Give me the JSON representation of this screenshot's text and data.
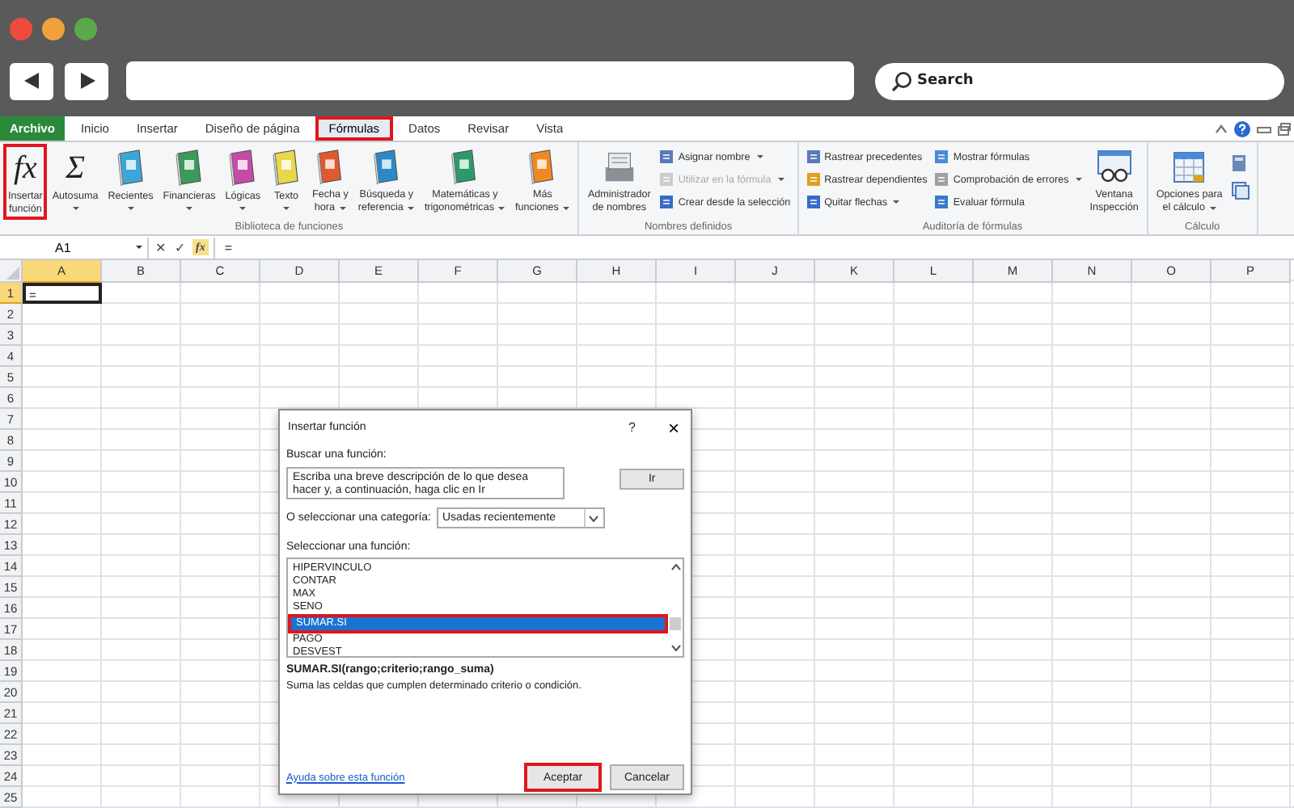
{
  "browser": {
    "search": {
      "placeholder": "Search"
    }
  },
  "ribbon": {
    "tabs": [
      {
        "label": "Archivo",
        "kind": "file",
        "selected": false,
        "highlighted": false
      },
      {
        "label": "Inicio",
        "kind": "tab",
        "selected": false,
        "highlighted": false
      },
      {
        "label": "Insertar",
        "kind": "tab",
        "selected": false,
        "highlighted": false
      },
      {
        "label": "Diseño de página",
        "kind": "tab",
        "selected": false,
        "highlighted": false
      },
      {
        "label": "Fórmulas",
        "kind": "tab",
        "selected": true,
        "highlighted": true
      },
      {
        "label": "Datos",
        "kind": "tab",
        "selected": false,
        "highlighted": false
      },
      {
        "label": "Revisar",
        "kind": "tab",
        "selected": false,
        "highlighted": false
      },
      {
        "label": "Vista",
        "kind": "tab",
        "selected": false,
        "highlighted": false
      }
    ],
    "groups": [
      {
        "label": "Biblioteca de funciones",
        "items": [
          {
            "kind": "large",
            "glyph": "fx",
            "lines": [
              "Insertar",
              "función"
            ],
            "dropdown": false,
            "highlighted": true
          },
          {
            "kind": "large",
            "glyph": "Σ",
            "lines": [
              "Autosuma"
            ],
            "dropdown": true,
            "highlighted": false
          },
          {
            "kind": "large",
            "lines": [
              "Recientes"
            ],
            "dropdown": true,
            "highlighted": false
          },
          {
            "kind": "large",
            "lines": [
              "Financieras"
            ],
            "dropdown": true,
            "highlighted": false
          },
          {
            "kind": "large",
            "lines": [
              "Lógicas"
            ],
            "dropdown": true,
            "highlighted": false
          },
          {
            "kind": "large",
            "lines": [
              "Texto"
            ],
            "dropdown": true,
            "highlighted": false
          },
          {
            "kind": "large",
            "lines": [
              "Fecha y",
              "hora"
            ],
            "dropdown": true,
            "highlighted": false
          },
          {
            "kind": "large",
            "lines": [
              "Búsqueda y",
              "referencia"
            ],
            "dropdown": true,
            "highlighted": false
          },
          {
            "kind": "large",
            "lines": [
              "Matemáticas y",
              "trigonométricas"
            ],
            "dropdown": true,
            "highlighted": false
          },
          {
            "kind": "large",
            "lines": [
              "Más",
              "funciones"
            ],
            "dropdown": true,
            "highlighted": false
          }
        ]
      },
      {
        "label": "Nombres definidos",
        "items": [
          {
            "kind": "large",
            "lines": [
              "Administrador",
              "de nombres"
            ],
            "dropdown": false,
            "highlighted": false
          },
          {
            "kind": "stack",
            "items": [
              {
                "label": "Asignar nombre",
                "dropdown": true,
                "disabled": false
              },
              {
                "label": "Utilizar en la fórmula",
                "dropdown": true,
                "disabled": true
              },
              {
                "label": "Crear desde la selección",
                "dropdown": false,
                "disabled": false
              }
            ]
          }
        ]
      },
      {
        "label": "Auditoría de fórmulas",
        "items": [
          {
            "kind": "stack",
            "items": [
              {
                "label": "Rastrear precedentes",
                "dropdown": false,
                "disabled": false
              },
              {
                "label": "Rastrear dependientes",
                "dropdown": false,
                "disabled": false
              },
              {
                "label": "Quitar flechas",
                "dropdown": true,
                "disabled": false
              }
            ]
          },
          {
            "kind": "stack",
            "items": [
              {
                "label": "Mostrar fórmulas",
                "dropdown": false,
                "disabled": false
              },
              {
                "label": "Comprobación de errores",
                "dropdown": true,
                "disabled": false
              },
              {
                "label": "Evaluar fórmula",
                "dropdown": false,
                "disabled": false
              }
            ]
          },
          {
            "kind": "large",
            "lines": [
              "Ventana",
              "Inspección"
            ],
            "dropdown": false,
            "highlighted": false
          }
        ]
      },
      {
        "label": "Cálculo",
        "items": [
          {
            "kind": "large",
            "lines": [
              "Opciones para",
              "el cálculo"
            ],
            "dropdown": true,
            "highlighted": false
          },
          {
            "kind": "icon_stack"
          }
        ]
      }
    ]
  },
  "formula_bar": {
    "name_box": "A1",
    "cancel": "✕",
    "enter": "✓",
    "function_glyph": "fx",
    "formula": "="
  },
  "sheet": {
    "columns": [
      {
        "label": "A",
        "selected": true
      },
      {
        "label": "B",
        "selected": false
      },
      {
        "label": "C",
        "selected": false
      },
      {
        "label": "D",
        "selected": false
      },
      {
        "label": "E",
        "selected": false
      },
      {
        "label": "F",
        "selected": false
      },
      {
        "label": "G",
        "selected": false
      },
      {
        "label": "H",
        "selected": false
      },
      {
        "label": "I",
        "selected": false
      },
      {
        "label": "J",
        "selected": false
      },
      {
        "label": "K",
        "selected": false
      },
      {
        "label": "L",
        "selected": false
      },
      {
        "label": "M",
        "selected": false
      },
      {
        "label": "N",
        "selected": false
      },
      {
        "label": "O",
        "selected": false
      },
      {
        "label": "P",
        "selected": false
      }
    ],
    "rows": [
      {
        "header": "1",
        "selected": true,
        "cells": [
          {
            "value": "=",
            "selected": true
          }
        ]
      },
      {
        "header": "2",
        "selected": false
      },
      {
        "header": "3",
        "selected": false
      },
      {
        "header": "4",
        "selected": false
      },
      {
        "header": "5",
        "selected": false
      },
      {
        "header": "6",
        "selected": false
      },
      {
        "header": "7",
        "selected": false
      },
      {
        "header": "8",
        "selected": false
      },
      {
        "header": "9",
        "selected": false
      },
      {
        "header": "10",
        "selected": false
      },
      {
        "header": "11",
        "selected": false
      },
      {
        "header": "12",
        "selected": false
      },
      {
        "header": "13",
        "selected": false
      },
      {
        "header": "14",
        "selected": false
      },
      {
        "header": "15",
        "selected": false
      },
      {
        "header": "16",
        "selected": false
      },
      {
        "header": "17",
        "selected": false
      },
      {
        "header": "18",
        "selected": false
      },
      {
        "header": "19",
        "selected": false
      },
      {
        "header": "20",
        "selected": false
      },
      {
        "header": "21",
        "selected": false
      },
      {
        "header": "22",
        "selected": false
      },
      {
        "header": "23",
        "selected": false
      },
      {
        "header": "24",
        "selected": false
      },
      {
        "header": "25",
        "selected": false
      }
    ]
  },
  "dialog": {
    "title": "Insertar función",
    "help": "?",
    "close": "×",
    "search_label": "Buscar una función:",
    "search_value": "Escriba una breve descripción de lo que desea hacer y, a continuación, haga clic en Ir",
    "go_button": "Ir",
    "category_label": "O seleccionar una categoría:",
    "category": "Usadas recientemente",
    "list_label": "Seleccionar una función:",
    "functions": [
      {
        "label": "HIPERVINCULO",
        "selected": false,
        "highlighted": false
      },
      {
        "label": "CONTAR",
        "selected": false,
        "highlighted": false
      },
      {
        "label": "MAX",
        "selected": false,
        "highlighted": false
      },
      {
        "label": "SENO",
        "selected": false,
        "highlighted": false
      },
      {
        "label": "SUMAR.SI",
        "selected": true,
        "highlighted": true
      },
      {
        "label": "PAGO",
        "selected": false,
        "highlighted": false
      },
      {
        "label": "DESVEST",
        "selected": false,
        "highlighted": false
      }
    ],
    "signature": "SUMAR.SI(rango;criterio;rango_suma)",
    "description": "Suma las celdas que cumplen determinado criterio o condición.",
    "help_link": "Ayuda sobre esta función",
    "buttons": [
      {
        "label": "Aceptar",
        "highlighted": true
      },
      {
        "label": "Cancelar",
        "highlighted": false
      }
    ]
  }
}
